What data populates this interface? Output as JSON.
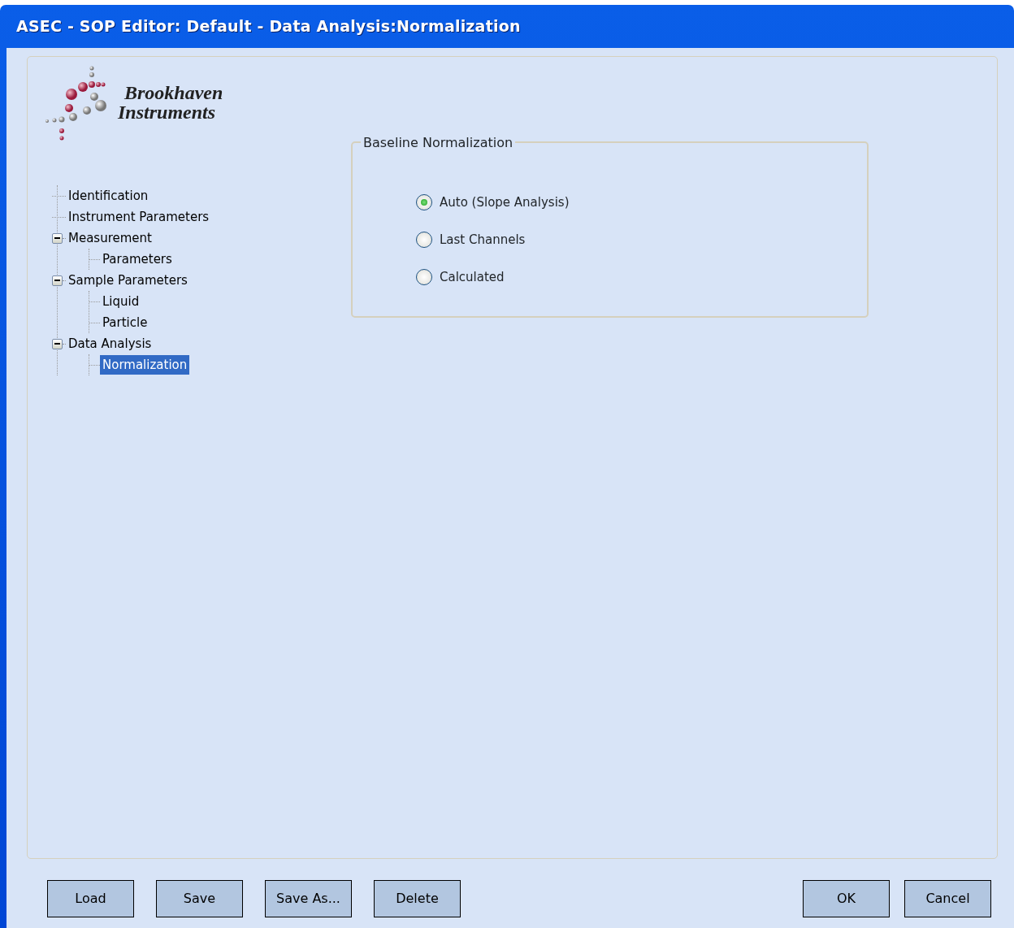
{
  "window": {
    "title": "ASEC - SOP Editor: Default - Data Analysis:Normalization"
  },
  "logo": {
    "lines": [
      "Brookhaven",
      "Instruments"
    ]
  },
  "tree": [
    {
      "label": "Identification",
      "selected": false
    },
    {
      "label": "Instrument Parameters",
      "selected": false
    },
    {
      "label": "Measurement",
      "selected": false,
      "expanded": true,
      "children": [
        {
          "label": "Parameters",
          "selected": false
        }
      ]
    },
    {
      "label": "Sample Parameters",
      "selected": false,
      "expanded": true,
      "children": [
        {
          "label": "Liquid",
          "selected": false
        },
        {
          "label": "Particle",
          "selected": false
        }
      ]
    },
    {
      "label": "Data Analysis",
      "selected": false,
      "expanded": true,
      "children": [
        {
          "label": "Normalization",
          "selected": true
        }
      ]
    }
  ],
  "group": {
    "title": "Baseline Normalization",
    "options": [
      {
        "label": "Auto (Slope Analysis)",
        "selected": true
      },
      {
        "label": "Last Channels",
        "selected": false
      },
      {
        "label": "Calculated",
        "selected": false
      }
    ]
  },
  "buttons_left": [
    "Load",
    "Save",
    "Save As...",
    "Delete"
  ],
  "buttons_right": [
    "OK",
    "Cancel"
  ]
}
